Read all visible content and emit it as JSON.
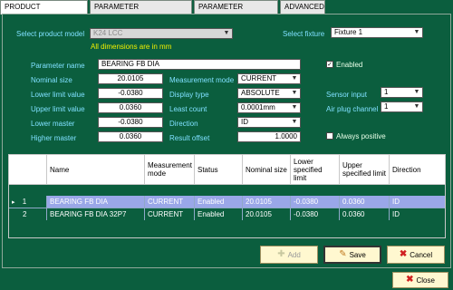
{
  "tabs": [
    {
      "label": "PRODUCT MANAGEMENT",
      "active": true
    },
    {
      "label": "PARAMETER CONFIGURATION",
      "active": false
    },
    {
      "label": "PARAMETER SEQUENCE",
      "active": false
    },
    {
      "label": "ADVANCED",
      "active": false
    }
  ],
  "form": {
    "select_product_model_label": "Select product model",
    "product_model_value": "K24 LCC",
    "dimensions_note": "All dimensions are in mm",
    "select_fixture_label": "Select fixture",
    "fixture_value": "Fixture 1",
    "parameter_name_label": "Parameter name",
    "parameter_name_value": "BEARING FB DIA",
    "enabled_label": "Enabled",
    "enabled_checked": "✓",
    "nominal_size_label": "Nominal size",
    "nominal_size_value": "20.0105",
    "lower_limit_label": "Lower limit value",
    "lower_limit_value": "-0.0380",
    "upper_limit_label": "Upper limit value",
    "upper_limit_value": "0.0360",
    "lower_master_label": "Lower master",
    "lower_master_value": "-0.0380",
    "higher_master_label": "Higher master",
    "higher_master_value": "0.0360",
    "measurement_mode_label": "Measurement mode",
    "measurement_mode_value": "CURRENT",
    "display_type_label": "Display type",
    "display_type_value": "ABSOLUTE",
    "least_count_label": "Least count",
    "least_count_value": "0.0001mm",
    "direction_label": "Direction",
    "direction_value": "ID",
    "result_offset_label": "Result offset",
    "result_offset_value": "1.0000",
    "sensor_input_label": "Sensor input",
    "sensor_input_value": "1",
    "air_plug_channel_label": "Air plug channel",
    "air_plug_channel_value": "1",
    "always_positive_label": "Always positive"
  },
  "table": {
    "headers": [
      "Name",
      "Measurement mode",
      "Status",
      "Nominal size",
      "Lower specified limit",
      "Upper specified limit",
      "Direction"
    ],
    "rows": [
      {
        "index": "1",
        "marker": "▸",
        "cells": [
          "BEARING FB DIA",
          "CURRENT",
          "Enabled",
          "20.0105",
          "-0.0380",
          "0.0360",
          "ID"
        ]
      },
      {
        "index": "2",
        "marker": "",
        "cells": [
          "BEARING FB DIA 32P7",
          "CURRENT",
          "Enabled",
          "20.0105",
          "-0.0380",
          "0.0360",
          "ID"
        ]
      }
    ]
  },
  "buttons": {
    "add": "Add",
    "save": "Save",
    "cancel": "Cancel",
    "close": "Close"
  },
  "colors": {
    "background": "#0b5e3e",
    "label": "#7fe0ff",
    "note": "#f0f000",
    "selected_row": "#9aa7e8"
  }
}
